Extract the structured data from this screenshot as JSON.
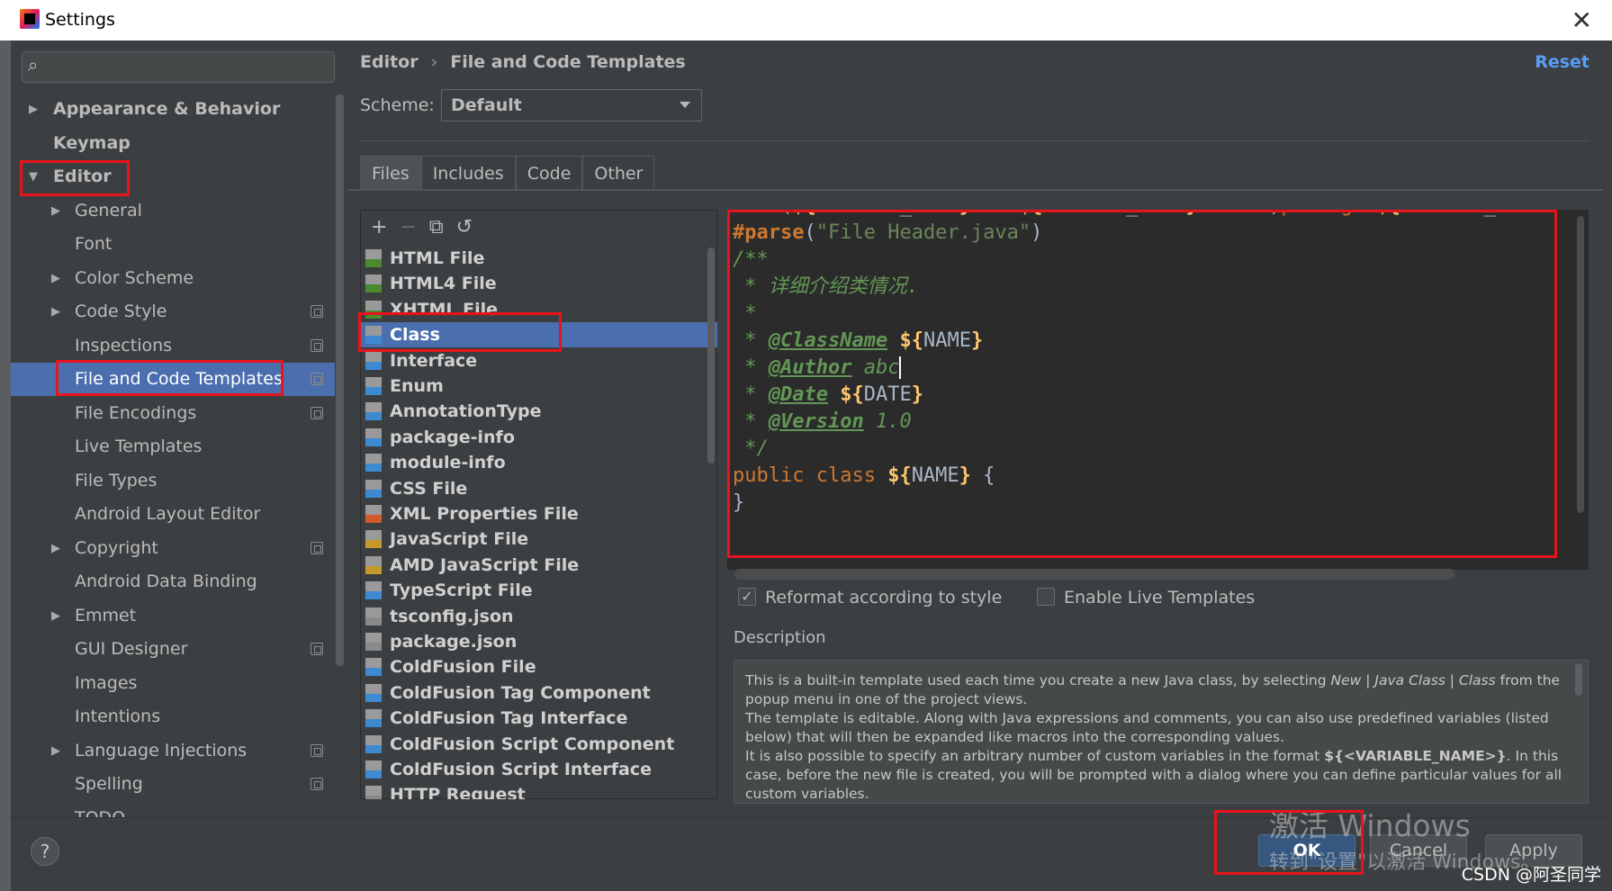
{
  "window": {
    "title": "Settings",
    "close_icon": "✕"
  },
  "sidebar": {
    "items": [
      {
        "label": "Appearance & Behavior",
        "arrow": "▶",
        "bold": true
      },
      {
        "label": "Keymap",
        "bold": true
      },
      {
        "label": "Editor",
        "arrow": "▼",
        "bold": true
      },
      {
        "label": "General",
        "arrow": "▶"
      },
      {
        "label": "Font"
      },
      {
        "label": "Color Scheme",
        "arrow": "▶"
      },
      {
        "label": "Code Style",
        "arrow": "▶"
      },
      {
        "label": "Inspections"
      },
      {
        "label": "File and Code Templates"
      },
      {
        "label": "File Encodings"
      },
      {
        "label": "Live Templates"
      },
      {
        "label": "File Types"
      },
      {
        "label": "Android Layout Editor"
      },
      {
        "label": "Copyright",
        "arrow": "▶"
      },
      {
        "label": "Android Data Binding"
      },
      {
        "label": "Emmet",
        "arrow": "▶"
      },
      {
        "label": "GUI Designer"
      },
      {
        "label": "Images"
      },
      {
        "label": "Intentions"
      },
      {
        "label": "Language Injections",
        "arrow": "▶"
      },
      {
        "label": "Spelling"
      },
      {
        "label": "TODO"
      }
    ]
  },
  "header": {
    "breadcrumb": [
      "Editor",
      "File and Code Templates"
    ],
    "breadcrumb_sep": "›",
    "reset_label": "Reset",
    "scheme_label": "Scheme:",
    "scheme_value": "Default"
  },
  "tabs": [
    "Files",
    "Includes",
    "Code",
    "Other"
  ],
  "toolbar": {
    "add": "+",
    "remove": "−",
    "copy": "⧉",
    "reset": "↺"
  },
  "templates": [
    {
      "label": "HTML File",
      "icon": "html-file-icon",
      "color": "#4b8a2f"
    },
    {
      "label": "HTML4 File",
      "icon": "html-file-icon",
      "color": "#4b8a2f"
    },
    {
      "label": "XHTML File",
      "icon": "html-file-icon",
      "color": "#4b8a2f"
    },
    {
      "label": "Class",
      "icon": "java-file-icon",
      "color": "#3d8ad0"
    },
    {
      "label": "Interface",
      "icon": "java-file-icon",
      "color": "#3d8ad0"
    },
    {
      "label": "Enum",
      "icon": "java-file-icon",
      "color": "#3d8ad0"
    },
    {
      "label": "AnnotationType",
      "icon": "java-file-icon",
      "color": "#3d8ad0"
    },
    {
      "label": "package-info",
      "icon": "java-file-icon",
      "color": "#3d8ad0"
    },
    {
      "label": "module-info",
      "icon": "java-file-icon",
      "color": "#3d8ad0"
    },
    {
      "label": "CSS File",
      "icon": "css-file-icon",
      "color": "#3d8ad0"
    },
    {
      "label": "XML Properties File",
      "icon": "xml-file-icon",
      "color": "#d25a2a"
    },
    {
      "label": "JavaScript File",
      "icon": "js-file-icon",
      "color": "#c49a2b"
    },
    {
      "label": "AMD JavaScript File",
      "icon": "js-file-icon",
      "color": "#c49a2b"
    },
    {
      "label": "TypeScript File",
      "icon": "ts-file-icon",
      "color": "#3d8ad0"
    },
    {
      "label": "tsconfig.json",
      "icon": "json-file-icon",
      "color": "#8a8a8a"
    },
    {
      "label": "package.json",
      "icon": "json-file-icon",
      "color": "#8a8a8a"
    },
    {
      "label": "ColdFusion File",
      "icon": "cf-file-icon",
      "color": "#3d8ad0"
    },
    {
      "label": "ColdFusion Tag Component",
      "icon": "cf-file-icon",
      "color": "#3d8ad0"
    },
    {
      "label": "ColdFusion Tag Interface",
      "icon": "cf-file-icon",
      "color": "#3d8ad0"
    },
    {
      "label": "ColdFusion Script Component",
      "icon": "cf-file-icon",
      "color": "#3d8ad0"
    },
    {
      "label": "ColdFusion Script Interface",
      "icon": "cf-file-icon",
      "color": "#3d8ad0"
    },
    {
      "label": "HTTP Request",
      "icon": "http-file-icon",
      "color": "#8a8a8a"
    }
  ],
  "editor": {
    "l1_a": "#if",
    "l1_b": " (",
    "l1_c": "${",
    "l1_d": "PACKAGE_NAME",
    "l1_e": "}",
    "l1_f": " && ",
    "l1_g": "${",
    "l1_h": "PACKAGE_NAME",
    "l1_i": "}",
    "l1_j": " != ",
    "l1_k": "\"\"",
    "l1_l": ")",
    "l1_m": "package ",
    "l1_n": "${",
    "l1_o": "PACKAGE_NAME",
    "l2_a": "#parse",
    "l2_b": "(",
    "l2_c": "\"File Header.java\"",
    "l2_d": ")",
    "l3": "/**",
    "l4": " * 详细介绍类情况.",
    "l5": " *",
    "l6_a": " * ",
    "l6_b": "@ClassName",
    "l6_c": " ${",
    "l6_d": "NAME",
    "l6_e": "}",
    "l7_a": " * ",
    "l7_b": "@Author",
    "l7_c": " abc",
    "l8_a": " * ",
    "l8_b": "@Date",
    "l8_c": " ${",
    "l8_d": "DATE",
    "l8_e": "}",
    "l9_a": " * ",
    "l9_b": "@Version",
    "l9_c": " 1.0",
    "l10": " */",
    "l11_a": "public class ",
    "l11_b": "${",
    "l11_c": "NAME",
    "l11_d": "}",
    "l11_e": " {",
    "l12": "}"
  },
  "options": {
    "reformat_label": "Reformat according to style",
    "reformat_checked": "✓",
    "live_label": "Enable Live Templates"
  },
  "description": {
    "label": "Description",
    "p1_a": "This is a built-in template used each time you create a new Java class, by selecting ",
    "p1_b": "New | Java Class | Class",
    "p1_c": " from the popup menu in one of the project views.",
    "p2": "The template is editable. Along with Java expressions and comments, you can also use predefined variables (listed below) that will then be expanded like macros into the corresponding values.",
    "p3_a": "It is also possible to specify an arbitrary number of custom variables in the format ",
    "p3_b": "${<VARIABLE_NAME>}",
    "p3_c": ". In this case, before the new file is created, you will be prompted with a dialog where you can define particular values for all custom variables."
  },
  "footer": {
    "help": "?",
    "ok": "OK",
    "cancel": "Cancel",
    "apply": "Apply"
  },
  "overlay": {
    "watermark_line1": "激活 Windows",
    "watermark_line2": "转到\"设置\"以激活 Windows。",
    "csdn": "CSDN @阿圣同学"
  },
  "colors": {
    "accent": "#4b6eaf",
    "highlight": "#e8141b",
    "link": "#589df6"
  }
}
